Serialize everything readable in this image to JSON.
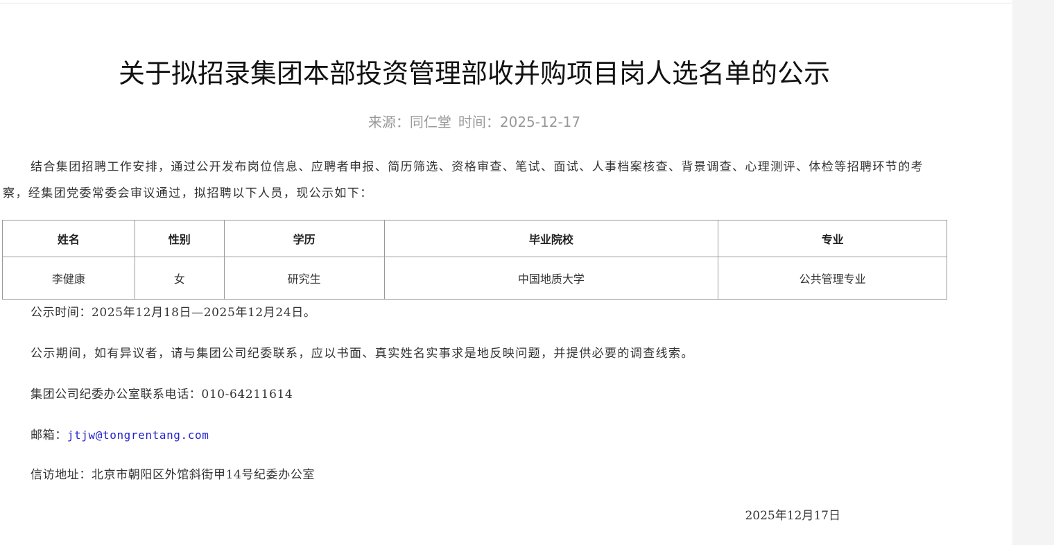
{
  "article": {
    "title": "关于拟招录集团本部投资管理部收并购项目岗人选名单的公示",
    "source_label": "来源：",
    "source": "同仁堂",
    "time_label": "时间：",
    "date": "2025-12-17",
    "intro": "结合集团招聘工作安排，通过公开发布岗位信息、应聘者申报、简历筛选、资格审查、笔试、面试、人事档案核查、背景调查、心理测评、体检等招聘环节的考察，经集团党委常委会审议通过，拟招聘以下人员，现公示如下：",
    "table": {
      "headers": [
        "姓名",
        "性别",
        "学历",
        "毕业院校",
        "专业"
      ],
      "rows": [
        [
          "李健康",
          "女",
          "研究生",
          "中国地质大学",
          "公共管理专业"
        ]
      ]
    },
    "notice_period": "公示时间：2025年12月18日—2025年12月24日。",
    "objection_note": "公示期间，如有异议者，请与集团公司纪委联系，应以书面、真实姓名实事求是地反映问题，并提供必要的调查线索。",
    "phone_line": "集团公司纪委办公室联系电话：010-64211614",
    "email_label": "邮箱：",
    "email": "jtjw@tongrentang.com",
    "address_line": "信访地址：北京市朝阳区外馆斜街甲14号纪委办公室",
    "sign_date": "2025年12月17日"
  },
  "colors": {
    "text": "#333333",
    "title": "#111111",
    "meta": "#999999",
    "link": "#2222cc",
    "table_border": "#999999"
  }
}
